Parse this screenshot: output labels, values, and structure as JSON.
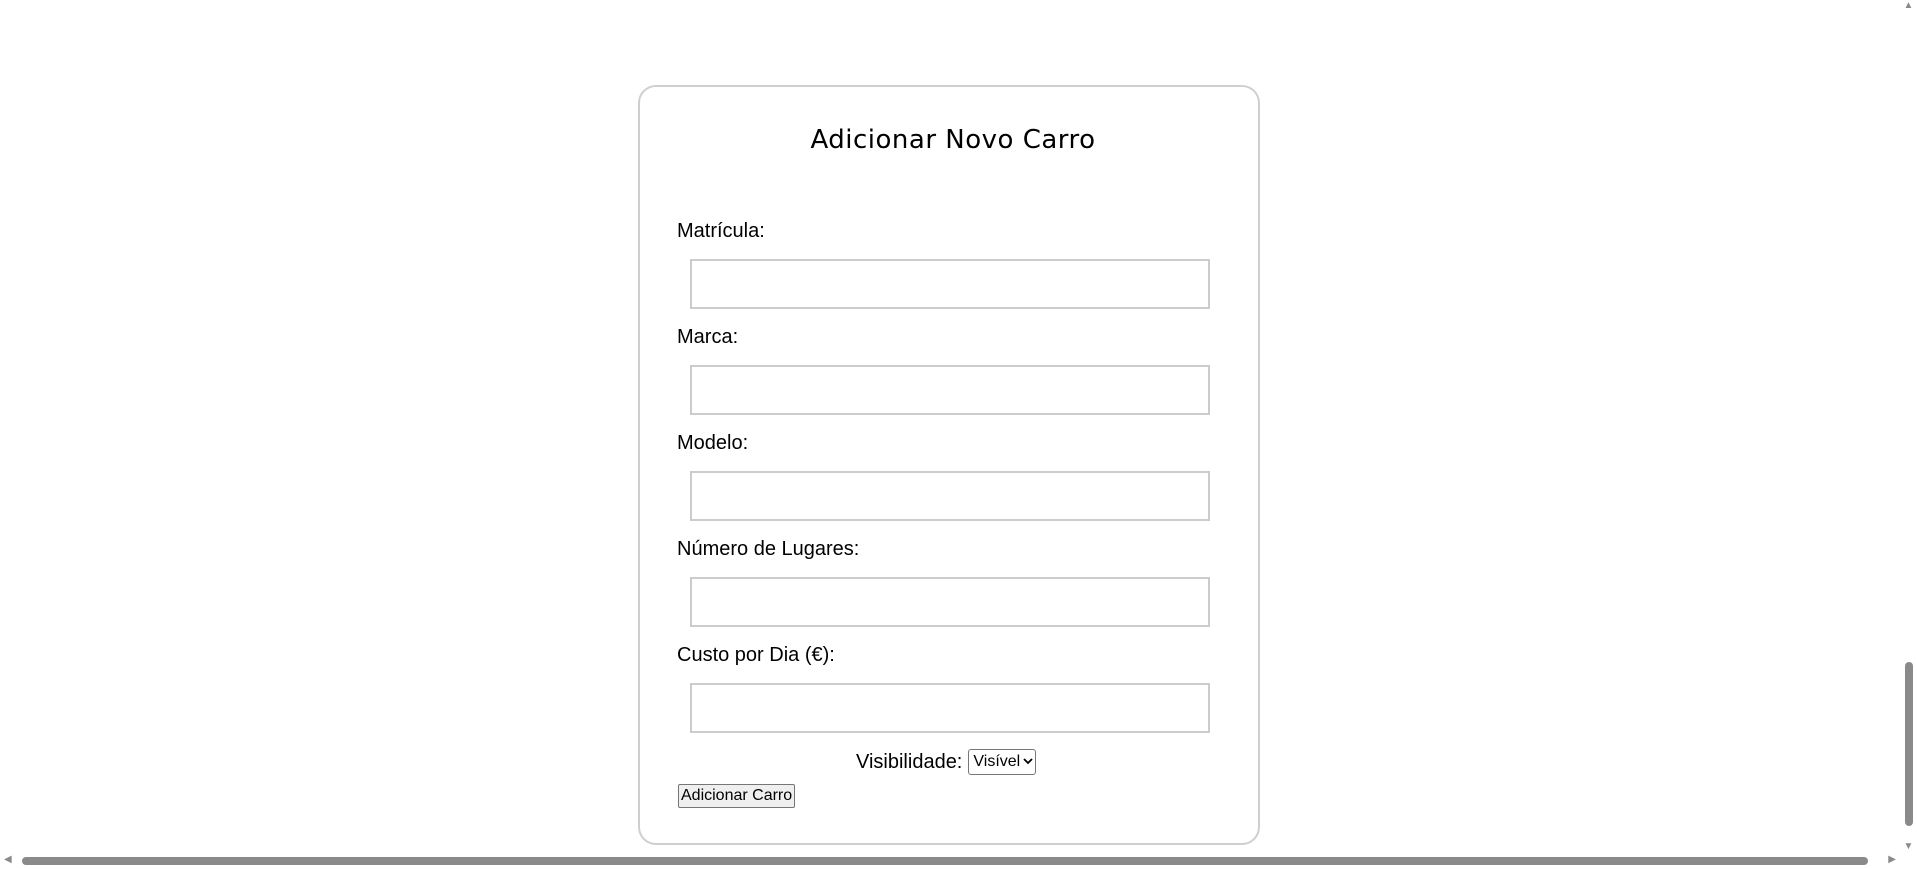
{
  "form": {
    "title": "Adicionar Novo Carro",
    "fields": [
      {
        "label": "Matrícula:",
        "value": ""
      },
      {
        "label": "Marca:",
        "value": ""
      },
      {
        "label": "Modelo:",
        "value": ""
      },
      {
        "label": "Número de Lugares:",
        "value": ""
      },
      {
        "label": "Custo por Dia (€):",
        "value": ""
      }
    ],
    "visibility": {
      "label": "Visibilidade:",
      "selected": "Visível"
    },
    "submit_label": "Adicionar Carro"
  },
  "icons": {
    "select_chevron": "chevron-down-icon",
    "scroll_up": "arrow-up-icon",
    "scroll_down": "arrow-down-icon",
    "scroll_left": "arrow-left-icon",
    "scroll_right": "arrow-right-icon"
  }
}
